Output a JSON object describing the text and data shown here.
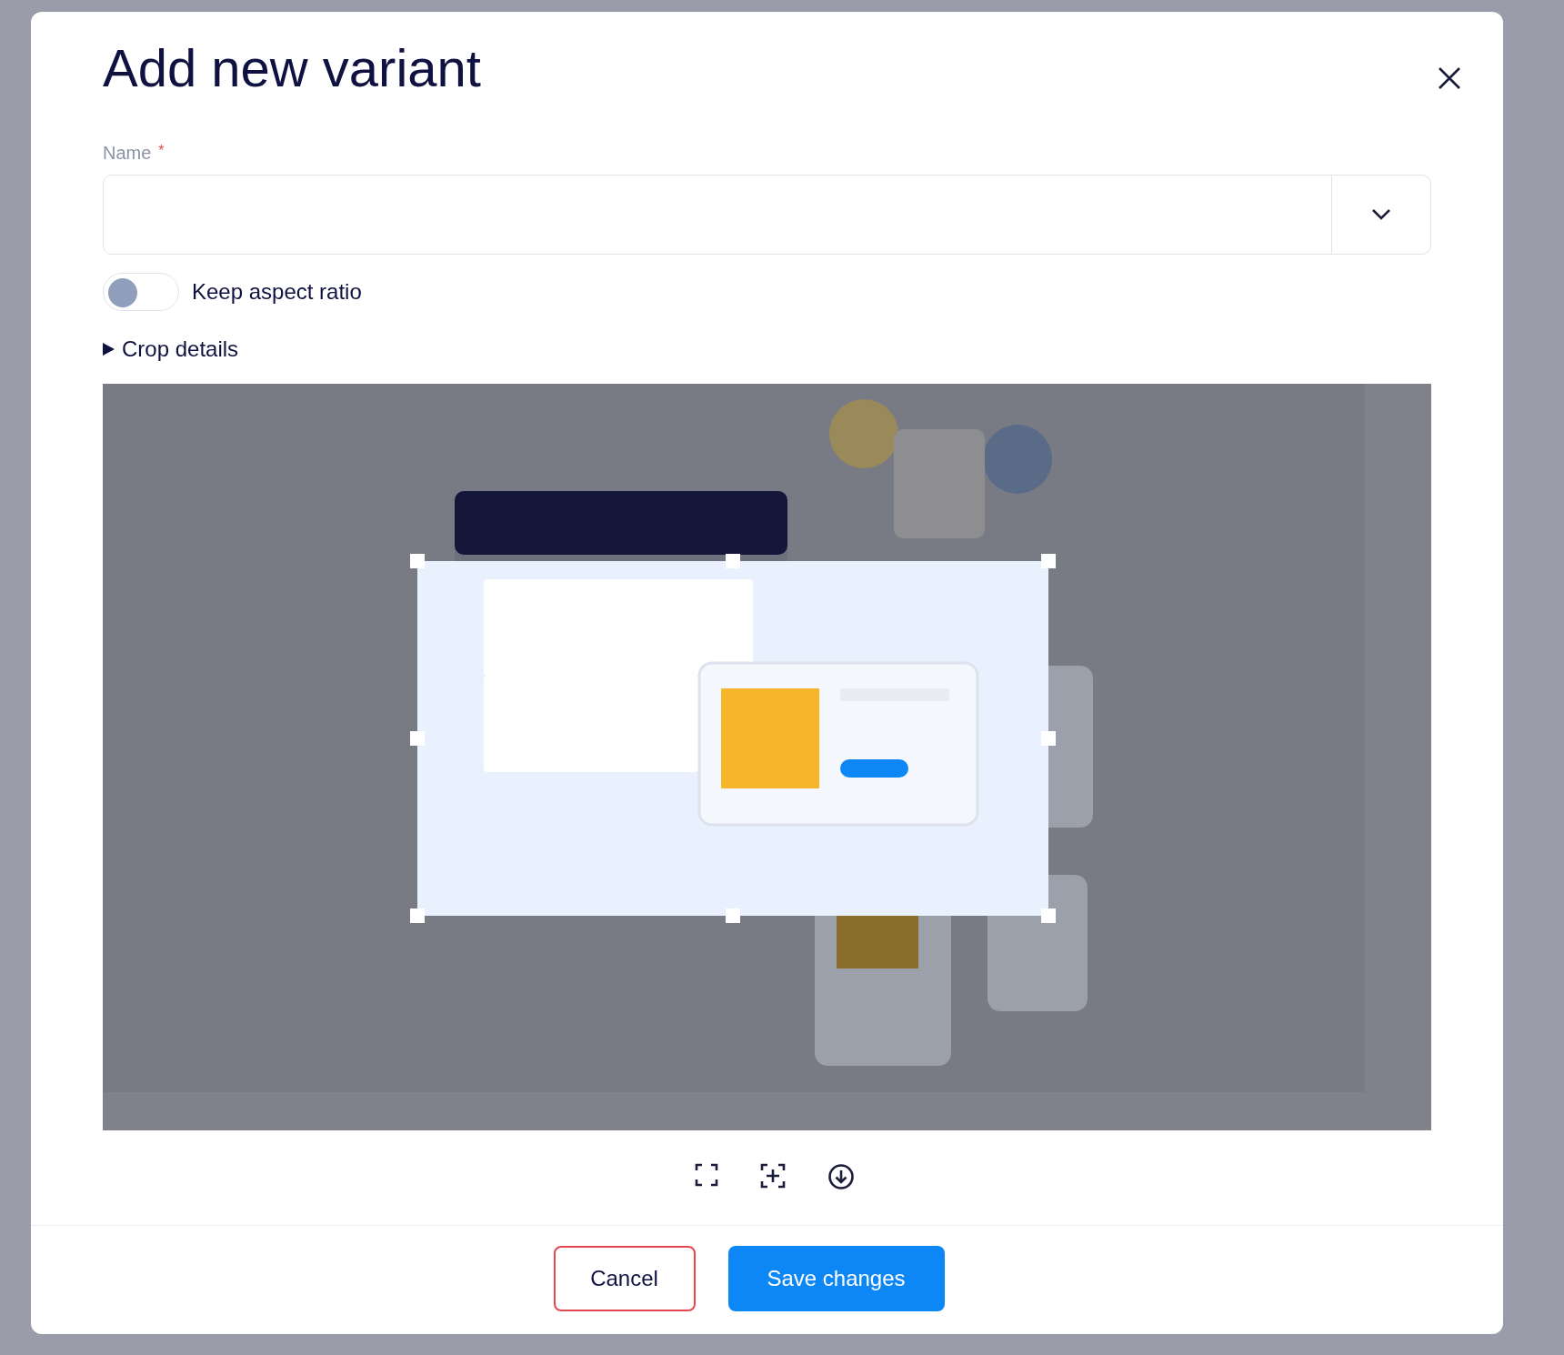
{
  "dialog": {
    "title": "Add new variant"
  },
  "name_field": {
    "label": "Name",
    "required_mark": "*",
    "required": true
  },
  "aspect_toggle": {
    "label": "Keep aspect ratio",
    "on": false
  },
  "crop_details": {
    "label": "Crop details",
    "expanded": false
  },
  "footer": {
    "buttons": [
      {
        "label": "Cancel",
        "kind": "secondary"
      },
      {
        "label": "Save changes",
        "kind": "primary"
      }
    ]
  }
}
